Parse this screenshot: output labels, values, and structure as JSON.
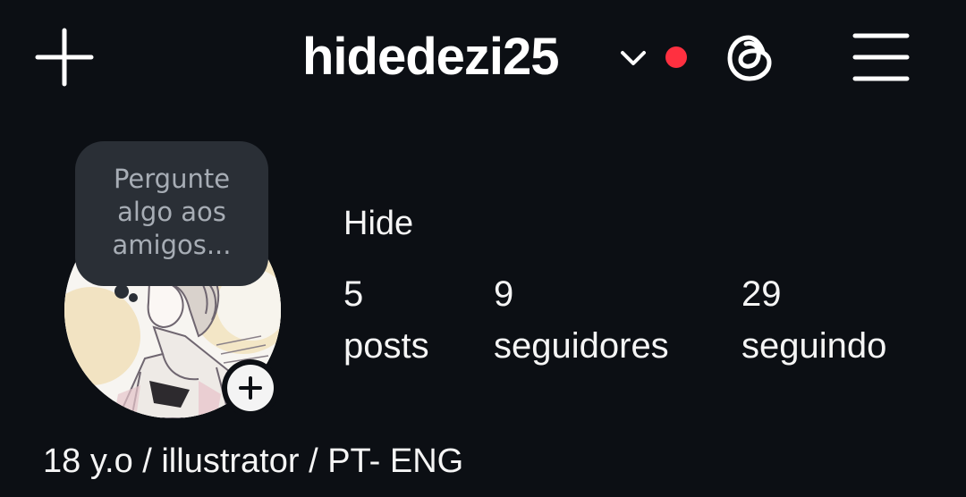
{
  "header": {
    "username": "hidedezi25",
    "notification_dot_color": "#ff3040",
    "icons": [
      "plus-icon",
      "chevron-down-icon",
      "threads-icon",
      "hamburger-menu-icon"
    ]
  },
  "note": {
    "placeholder": "Pergunte algo aos amigos..."
  },
  "profile": {
    "display_name": "Hide",
    "stats": {
      "posts": {
        "value": "5",
        "label": "posts"
      },
      "followers": {
        "value": "9",
        "label": "seguidores"
      },
      "following": {
        "value": "29",
        "label": "seguindo"
      }
    },
    "bio": "18 y.o / illustrator / PT- ENG"
  },
  "colors": {
    "background": "#0c0f14",
    "text": "#f5f5f5",
    "bubble": "#2a2f36",
    "bubble_text": "#a7adb5"
  }
}
